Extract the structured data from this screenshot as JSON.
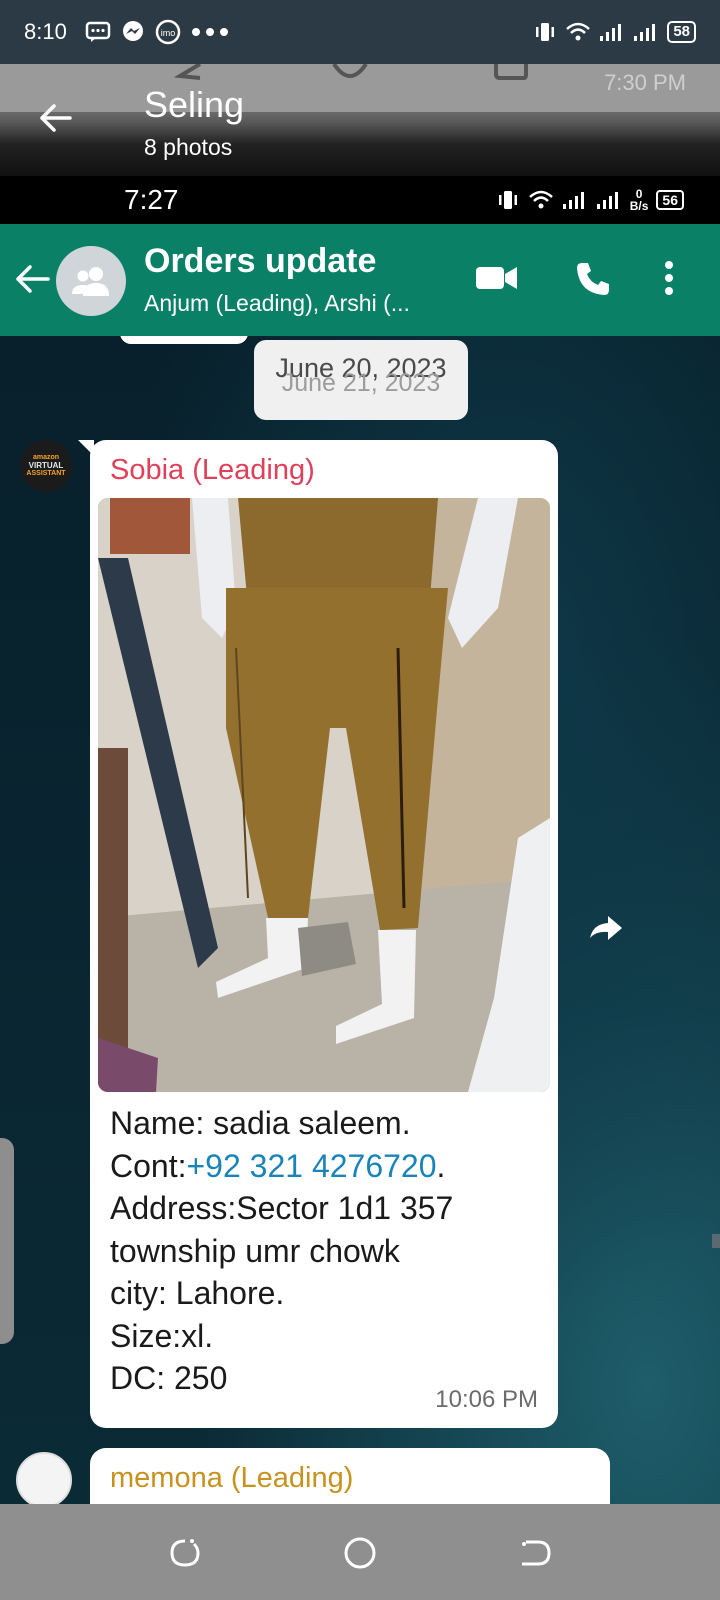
{
  "status_bar": {
    "time": "8:10",
    "left_icons": [
      "chat-bubble-icon",
      "messenger-icon",
      "imo-icon",
      "more-dots-icon"
    ],
    "battery": "58"
  },
  "viewer": {
    "title": "Seling",
    "subtitle": "8 photos",
    "ghost_time": "7:30 PM"
  },
  "inner_status": {
    "time": "7:27",
    "speed_value": "0",
    "speed_unit": "B/s",
    "battery": "56"
  },
  "chat": {
    "title": "Orders update",
    "members": "Anjum (Leading), Arshi (...",
    "accent": "#0a8067"
  },
  "date_chip": {
    "label": "June 20, 2023",
    "ghost": "June 21, 2023"
  },
  "avatar": {
    "line1": "amazon",
    "line2": "VIRTUAL",
    "line3": "ASSISTANT"
  },
  "message": {
    "sender": "Sobia (Leading)",
    "sender_color": "#e0405a",
    "line1": "Name: sadia saleem.",
    "cont_label": "Cont:",
    "phone": "+92 321 4276720",
    "cont_end": ".",
    "line3": "Address:Sector 1d1 357",
    "line4": "township umr chowk",
    "line5": "city: Lahore.",
    "line6": "Size:xl.",
    "line7": "DC: 250",
    "time": "10:06 PM"
  },
  "next_message": {
    "sender": "memona (Leading)",
    "sender_color": "#c7921e"
  },
  "nav": [
    "recent-apps-icon",
    "home-icon",
    "back-nav-icon"
  ]
}
